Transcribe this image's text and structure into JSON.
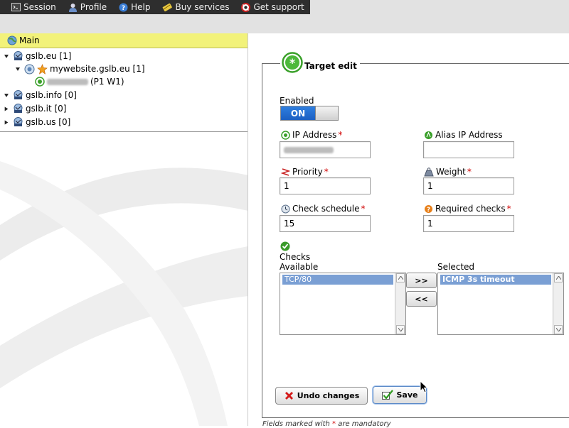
{
  "menu": [
    {
      "label": "Session",
      "icon": "terminal-icon"
    },
    {
      "label": "Profile",
      "icon": "user-icon"
    },
    {
      "label": "Help",
      "icon": "help-icon"
    },
    {
      "label": "Buy services",
      "icon": "card-icon"
    },
    {
      "label": "Get support",
      "icon": "lifebuoy-icon"
    }
  ],
  "tree": {
    "header": "Main",
    "nodes": [
      {
        "label": "gslb.eu [1]",
        "expanded": true
      },
      {
        "label": "mywebsite.gslb.eu [1]",
        "expanded": true
      },
      {
        "label": "(P1 W1)",
        "redacted_prefix": true
      },
      {
        "label": "gslb.info [0]",
        "expanded": true
      },
      {
        "label": "gslb.it [0]",
        "expanded": false
      },
      {
        "label": "gslb.us [0]",
        "expanded": false
      }
    ]
  },
  "form": {
    "title": "Target edit",
    "enabled_label": "Enabled",
    "toggle_label": "ON",
    "ip_label": "IP Address",
    "alias_label": "Alias IP Address",
    "alias_value": "",
    "priority_label": "Priority",
    "priority_value": "1",
    "weight_label": "Weight",
    "weight_value": "1",
    "schedule_label": "Check schedule",
    "schedule_value": "15",
    "required_label": "Required checks",
    "required_value": "1",
    "checks_label": "Checks",
    "available_label": "Available",
    "available_items": [
      "TCP/80"
    ],
    "selected_label": "Selected",
    "selected_items": [
      "ICMP 3s timeout"
    ],
    "add_label": ">>",
    "remove_label": "<<",
    "undo_label": "Undo changes",
    "save_label": "Save",
    "required_mark": "*",
    "footnote_before": "Fields marked with ",
    "footnote_after": " are mandatory"
  },
  "colors": {
    "menubar": "#2e2e2e",
    "tree_header": "#f2f27a",
    "toggle_on": "#1c5fc2",
    "list_selection": "#7a9fd4",
    "required": "#d00000"
  }
}
